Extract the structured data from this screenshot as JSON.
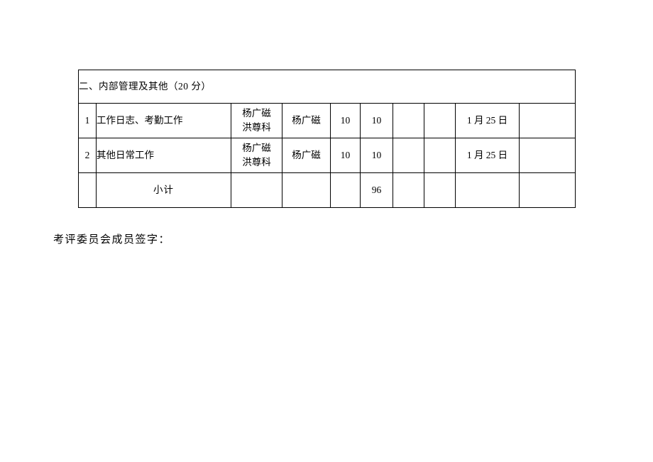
{
  "table": {
    "section_header": "二、内部管理及其他（20 分）",
    "rows": [
      {
        "no": "1",
        "item": "工作日志、考勤工作",
        "dept_line1": "杨广磁",
        "dept_line2": "洪尊科",
        "person": "杨广磁",
        "score1": "10",
        "score2": "10",
        "blank1": "",
        "blank2": "",
        "date": "1 月 25 日",
        "blank3": ""
      },
      {
        "no": "2",
        "item": "其他日常工作",
        "dept_line1": "杨广磁",
        "dept_line2": "洪尊科",
        "person": "杨广磁",
        "score1": "10",
        "score2": "10",
        "blank1": "",
        "blank2": "",
        "date": "1 月 25 日",
        "blank3": ""
      }
    ],
    "total_row": {
      "no": "",
      "label": "小计",
      "dept": "",
      "person": "",
      "score1": "",
      "score2": "96",
      "blank1": "",
      "blank2": "",
      "date": "",
      "blank3": ""
    }
  },
  "footer": {
    "signature_line": "考评委员会成员签字："
  }
}
